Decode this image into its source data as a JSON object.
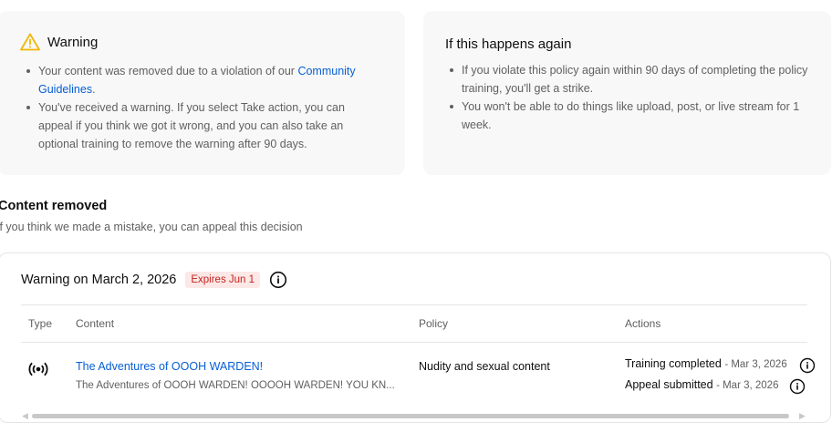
{
  "warning_card": {
    "title": "Warning",
    "bullet1_text": "Your content was removed due to a violation of our ",
    "bullet1_link": "Community Guidelines",
    "bullet1_end": ".",
    "bullet2": "You've received a warning. If you select Take action, you can appeal if you think we got it wrong, and you can also take an optional training to remove the warning after 90 days."
  },
  "again_card": {
    "title": "If this happens again",
    "bullets": [
      "If you violate this policy again within 90 days of completing the policy training, you'll get a strike.",
      "You won't be able to do things like upload, post, or live stream for 1 week."
    ]
  },
  "section": {
    "title": "Content removed",
    "subtitle": "If you think we made a mistake, you can appeal this decision"
  },
  "panel": {
    "title": "Warning on March 2, 2026",
    "badge": "Expires Jun 1",
    "columns": [
      "Type",
      "Content",
      "Policy",
      "Actions"
    ],
    "row": {
      "type_icon": "live-broadcast-icon",
      "content_title": "The Adventures of OOOH WARDEN!",
      "content_desc": "The Adventures of OOOH WARDEN! OOOOH WARDEN! YOU KN...",
      "policy": "Nudity and sexual content",
      "actions": [
        {
          "label": "Training completed",
          "date": "- Mar 3, 2026"
        },
        {
          "label": "Appeal submitted",
          "date": "- Mar 3, 2026"
        }
      ]
    }
  },
  "colors": {
    "warning_icon": "#f2b705",
    "link": "#065fd4",
    "badge_bg": "#fce8e6",
    "badge_text": "#c5221f"
  }
}
